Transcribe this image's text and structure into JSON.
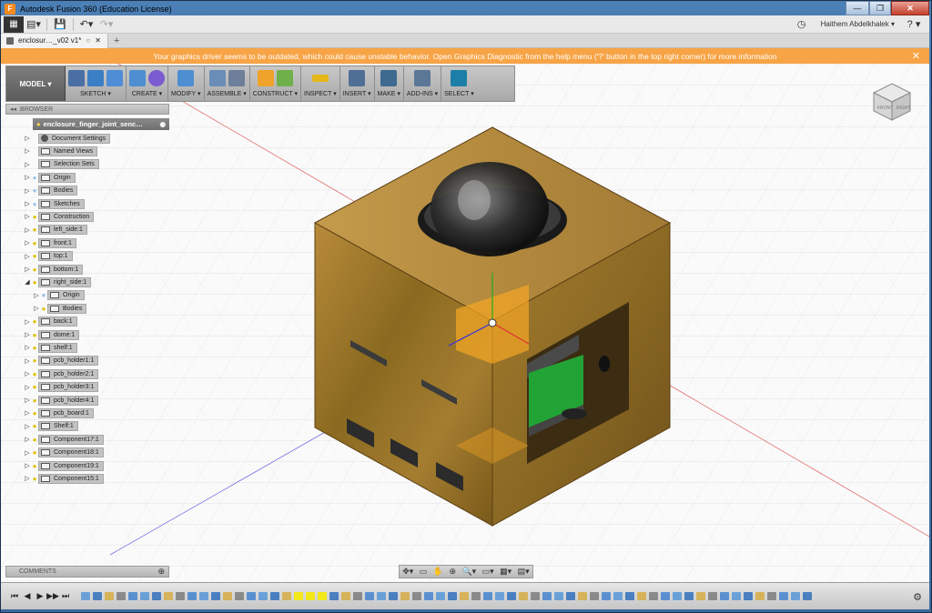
{
  "window": {
    "title": "Autodesk Fusion 360 (Education License)",
    "app_icon": "F",
    "min": "—",
    "max": "❐",
    "close": "✕"
  },
  "appbar": {
    "user": "Haithem Abdelkhalek ▾",
    "help": "? ▾"
  },
  "tab": {
    "label": "enclosur…_v02 v1*",
    "close": "✕",
    "add": "+"
  },
  "warning": {
    "text": "Your graphics driver seems to be outdated, which could cause unstable behavior. Open Graphics Diagnostic from the help menu ('?' button in the top right corner) for more information",
    "close": "✕"
  },
  "toolbar": {
    "model": "MODEL ▾",
    "groups": [
      {
        "label": "SKETCH ▾",
        "icons": [
          "#4a6fa5",
          "#3b7fc4",
          "#4f8dd6"
        ]
      },
      {
        "label": "CREATE ▾",
        "icons": [
          "#4d8fd1",
          "#7b5bd0"
        ]
      },
      {
        "label": "MODIFY ▾",
        "icons": [
          "#4e8fd2"
        ]
      },
      {
        "label": "ASSEMBLE ▾",
        "icons": [
          "#6a8db8",
          "#6d7f99"
        ]
      },
      {
        "label": "CONSTRUCT ▾",
        "icons": [
          "#f0a32a",
          "#6fb04a"
        ]
      },
      {
        "label": "INSPECT ▾",
        "icons": [
          "#e5b71a"
        ]
      },
      {
        "label": "INSERT ▾",
        "icons": [
          "#4f6f95"
        ]
      },
      {
        "label": "MAKE ▾",
        "icons": [
          "#3d6a8e"
        ]
      },
      {
        "label": "ADD-INS ▾",
        "icons": [
          "#5a7896"
        ]
      },
      {
        "label": "SELECT ▾",
        "icons": [
          "#1b7fa8"
        ]
      }
    ]
  },
  "browser": {
    "title": "BROWSER",
    "root": "enclosure_finger_joint_senc…",
    "items": [
      {
        "label": "Document Settings",
        "level": 1,
        "tri": "▷",
        "bulb": false,
        "icon": "gear"
      },
      {
        "label": "Named Views",
        "level": 1,
        "tri": "▷",
        "bulb": false
      },
      {
        "label": "Selection Sets",
        "level": 1,
        "tri": "▷",
        "bulb": false
      },
      {
        "label": "Origin",
        "level": 1,
        "tri": "▷",
        "bulb": true,
        "off": true
      },
      {
        "label": "Bodies",
        "level": 1,
        "tri": "▷",
        "bulb": true,
        "off": true
      },
      {
        "label": "Sketches",
        "level": 1,
        "tri": "▷",
        "bulb": true,
        "off": true
      },
      {
        "label": "Construction",
        "level": 1,
        "tri": "▷",
        "bulb": true
      },
      {
        "label": "left_side:1",
        "level": 1,
        "tri": "▷",
        "bulb": true
      },
      {
        "label": "front:1",
        "level": 1,
        "tri": "▷",
        "bulb": true
      },
      {
        "label": "top:1",
        "level": 1,
        "tri": "▷",
        "bulb": true
      },
      {
        "label": "bottom:1",
        "level": 1,
        "tri": "▷",
        "bulb": true
      },
      {
        "label": "right_side:1",
        "level": 1,
        "tri": "◢",
        "bulb": true
      },
      {
        "label": "Origin",
        "level": 2,
        "tri": "▷",
        "bulb": true,
        "off": true
      },
      {
        "label": "Bodies",
        "level": 2,
        "tri": "▷",
        "bulb": true
      },
      {
        "label": "back:1",
        "level": 1,
        "tri": "▷",
        "bulb": true
      },
      {
        "label": "dome:1",
        "level": 1,
        "tri": "▷",
        "bulb": true
      },
      {
        "label": "shelf:1",
        "level": 1,
        "tri": "▷",
        "bulb": true
      },
      {
        "label": "pcb_holder1:1",
        "level": 1,
        "tri": "▷",
        "bulb": true
      },
      {
        "label": "pcb_holder2:1",
        "level": 1,
        "tri": "▷",
        "bulb": true
      },
      {
        "label": "pcb_holder3:1",
        "level": 1,
        "tri": "▷",
        "bulb": true
      },
      {
        "label": "pcb_holder4:1",
        "level": 1,
        "tri": "▷",
        "bulb": true
      },
      {
        "label": "pcb_board:1",
        "level": 1,
        "tri": "▷",
        "bulb": true
      },
      {
        "label": "Shelf:1",
        "level": 1,
        "tri": "▷",
        "bulb": true
      },
      {
        "label": "Component17:1",
        "level": 1,
        "tri": "▷",
        "bulb": true
      },
      {
        "label": "Component18:1",
        "level": 1,
        "tri": "▷",
        "bulb": true
      },
      {
        "label": "Component19:1",
        "level": 1,
        "tri": "▷",
        "bulb": true
      },
      {
        "label": "Component15:1",
        "level": 1,
        "tri": "▷",
        "bulb": true
      }
    ]
  },
  "comments": {
    "label": "COMMENTS",
    "add": "⊕"
  },
  "viewcube": {
    "front": "FRONT",
    "right": "RIGHT"
  },
  "navbar": {
    "items": [
      "✥▾",
      "▭",
      "✋",
      "⊕",
      "🔍▾",
      "▭▾",
      "▦▾",
      "▤▾"
    ]
  },
  "timeline": {
    "controls": [
      "⏮",
      "◀",
      "▶",
      "▶▶",
      "⏭"
    ],
    "gear": "⚙"
  }
}
